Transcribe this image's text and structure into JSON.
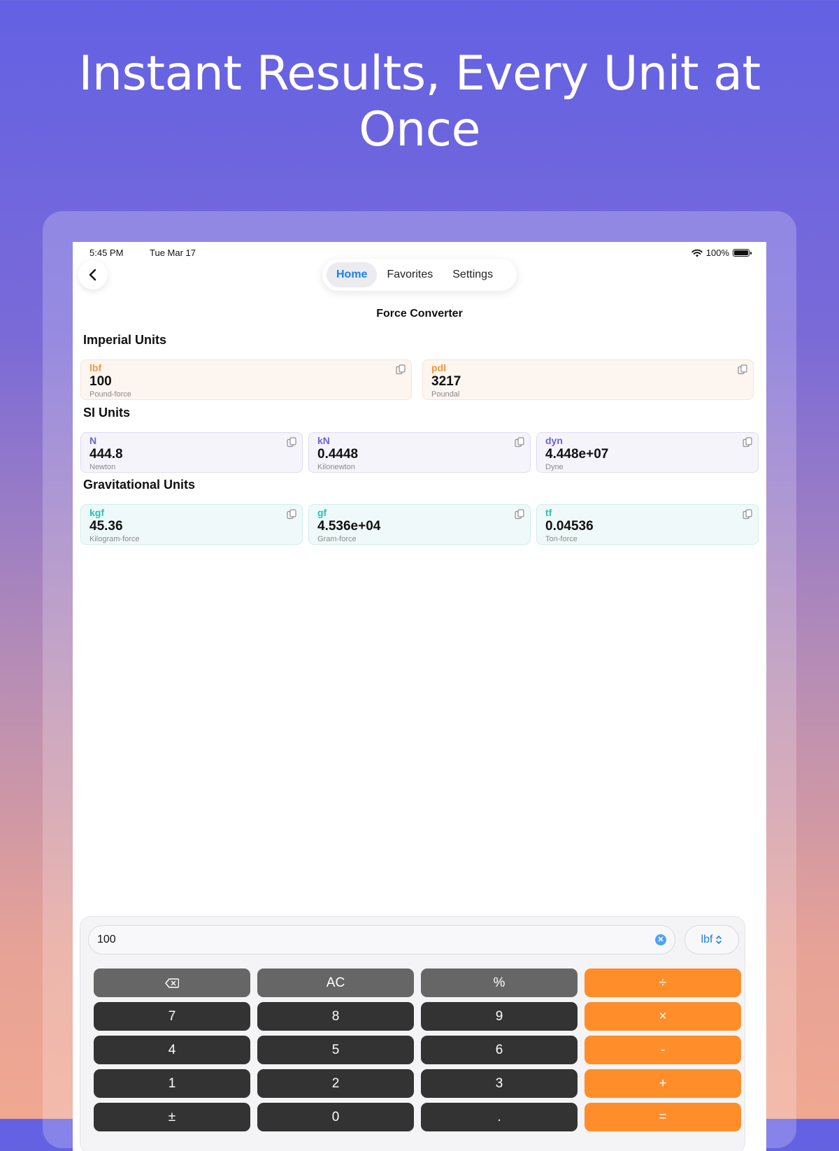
{
  "headline": [
    "Instant Results, Every Unit at",
    "Once"
  ],
  "status": {
    "time": "5:45 PM",
    "date": "Tue Mar 17",
    "battery": "100%"
  },
  "nav": {
    "tabs": [
      {
        "label": "Home",
        "active": true
      },
      {
        "label": "Favorites"
      },
      {
        "label": "Settings"
      }
    ],
    "title": "Force Converter"
  },
  "sections": [
    {
      "title": "Imperial Units",
      "units": [
        {
          "symbol": "lbf",
          "value": "100",
          "name": "Pound-force"
        },
        {
          "symbol": "pdl",
          "value": "3217",
          "name": "Poundal"
        }
      ]
    },
    {
      "title": "SI Units",
      "units": [
        {
          "symbol": "N",
          "value": "444.8",
          "name": "Newton"
        },
        {
          "symbol": "kN",
          "value": "0.4448",
          "name": "Kilonewton"
        },
        {
          "symbol": "dyn",
          "value": "4.448e+07",
          "name": "Dyne"
        }
      ]
    },
    {
      "title": "Gravitational Units",
      "units": [
        {
          "symbol": "kgf",
          "value": "45.36",
          "name": "Kilogram-force"
        },
        {
          "symbol": "gf",
          "value": "4.536e+04",
          "name": "Gram-force"
        },
        {
          "symbol": "tf",
          "value": "0.04536",
          "name": "Ton-force"
        }
      ]
    }
  ],
  "calculator": {
    "input_value": "100",
    "unit": "lbf",
    "keys": [
      [
        {
          "label": "⌫",
          "icon": "backspace-icon"
        },
        {
          "label": "AC"
        },
        {
          "label": "%"
        },
        {
          "label": "÷"
        }
      ],
      [
        {
          "label": "7"
        },
        {
          "label": "8"
        },
        {
          "label": "9"
        },
        {
          "label": "×"
        }
      ],
      [
        {
          "label": "4"
        },
        {
          "label": "5"
        },
        {
          "label": "6"
        },
        {
          "label": "-"
        }
      ],
      [
        {
          "label": "1"
        },
        {
          "label": "2"
        },
        {
          "label": "3"
        },
        {
          "label": "+"
        }
      ],
      [
        {
          "label": "±"
        },
        {
          "label": "0"
        },
        {
          "label": "."
        },
        {
          "label": "="
        }
      ]
    ]
  },
  "colors": {
    "accent": "#1a7ef0",
    "imperial": "#f5963a",
    "si": "#6a63d8",
    "gravitational": "#26c4b6",
    "operator_key": "#ff8e2a",
    "number_key": "#333333",
    "utility_key": "#666666"
  }
}
